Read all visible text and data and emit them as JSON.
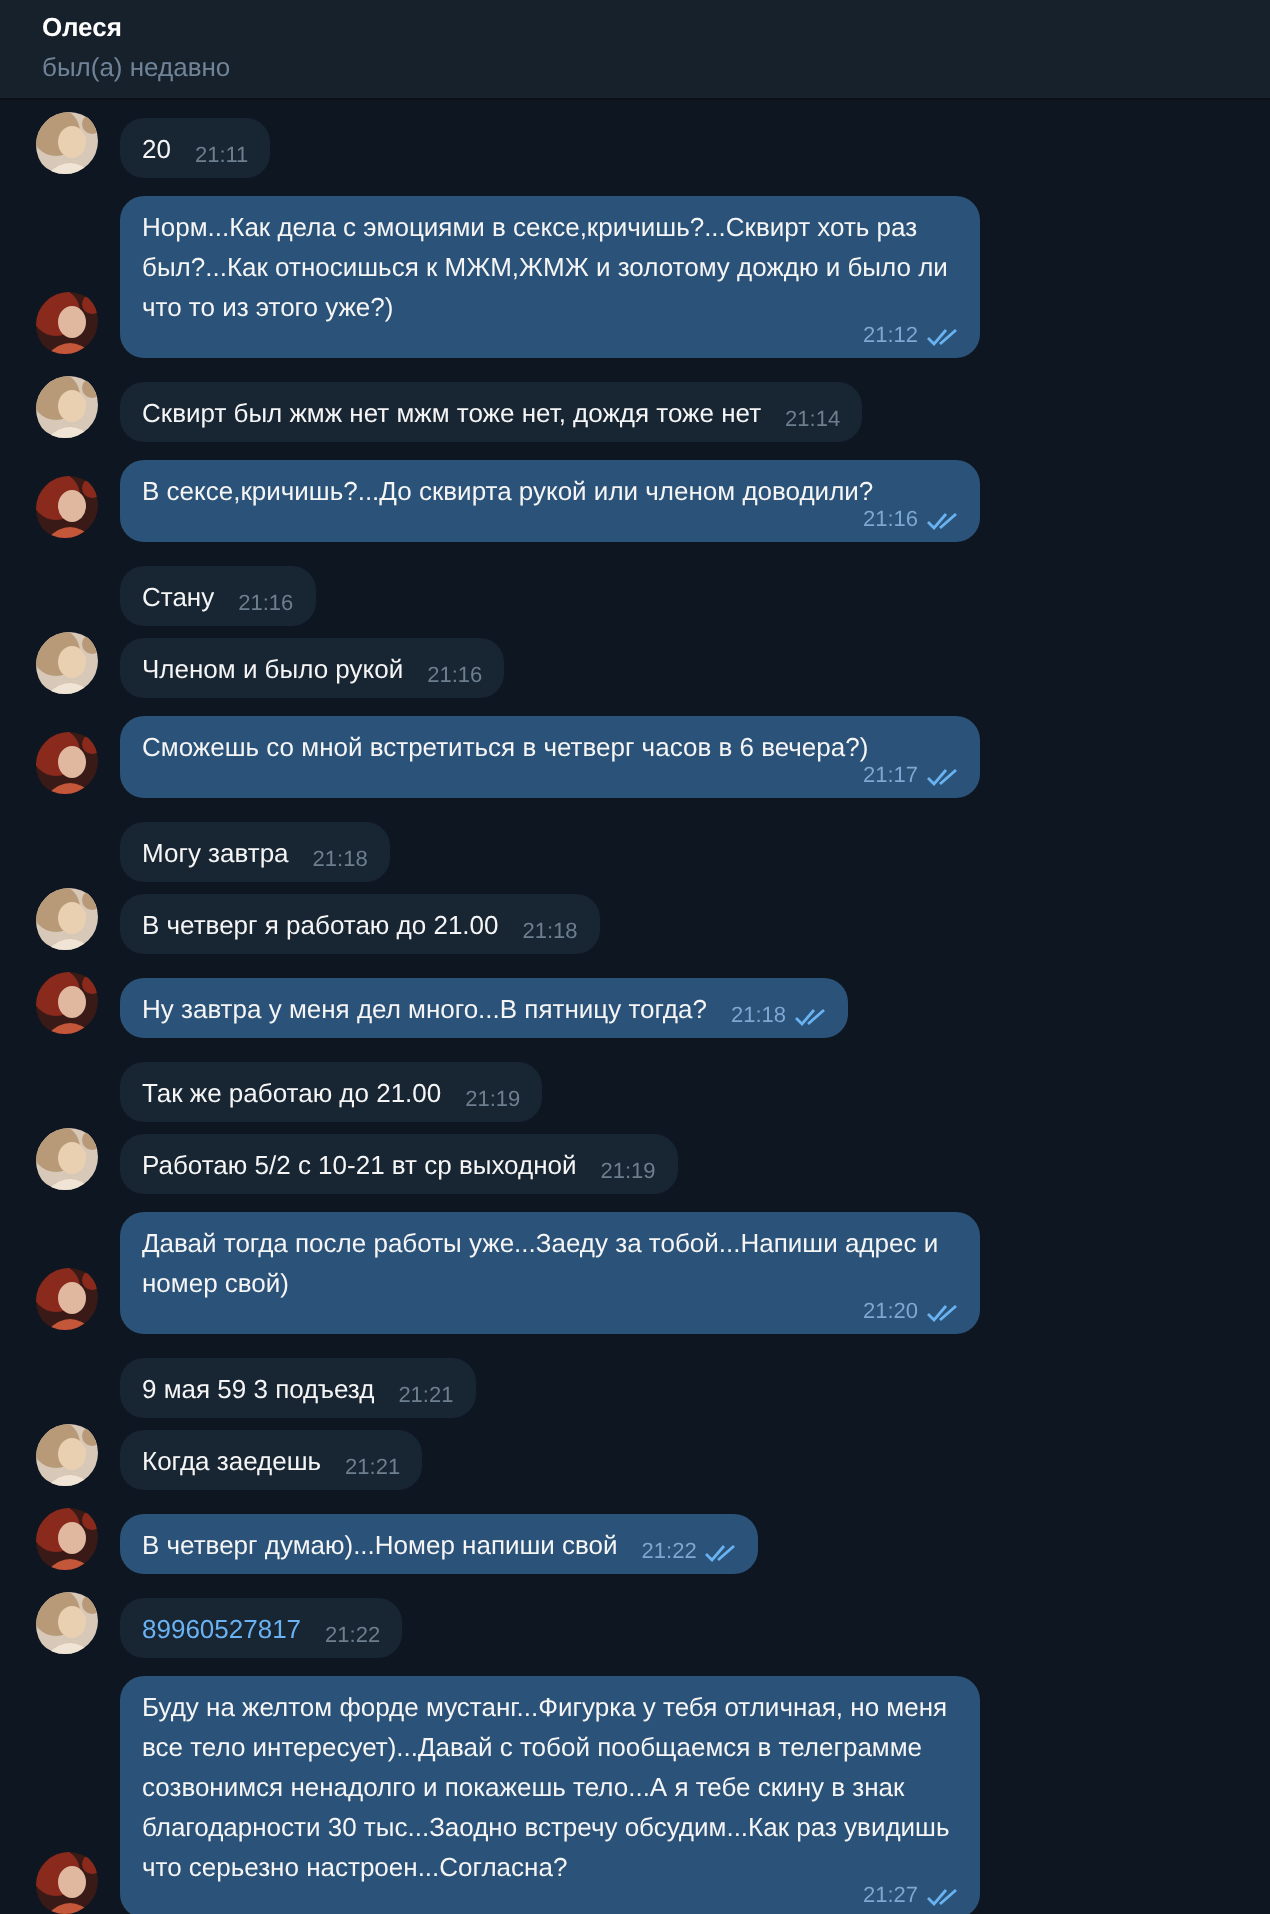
{
  "header": {
    "title": "Олеся",
    "status": "был(а) недавно"
  },
  "messages": [
    {
      "kind": "incoming",
      "text": "20",
      "time": "21:11"
    },
    {
      "kind": "outgoing",
      "text": "Норм...Как дела с эмоциями в сексе,кричишь?...Сквирт хоть раз был?...Как относишься к МЖМ,ЖМЖ и золотому дождю и было ли что то из этого уже?)",
      "time": "21:12",
      "read": true
    },
    {
      "kind": "incoming",
      "text": "Сквирт был жмж нет мжм тоже нет, дождя тоже нет",
      "time": "21:14"
    },
    {
      "kind": "outgoing",
      "text": "В сексе,кричишь?...До сквирта рукой или членом доводили?",
      "time": "21:16",
      "read": true
    },
    {
      "kind": "incoming",
      "text": "Стану",
      "time": "21:16"
    },
    {
      "kind": "incoming",
      "text": "Членом и было рукой",
      "time": "21:16"
    },
    {
      "kind": "outgoing",
      "text": "Сможешь со мной встретиться в четверг часов в 6 вечера?)",
      "time": "21:17",
      "read": true
    },
    {
      "kind": "incoming",
      "text": "Могу завтра",
      "time": "21:18"
    },
    {
      "kind": "incoming",
      "text": "В четверг я работаю до 21.00",
      "time": "21:18"
    },
    {
      "kind": "outgoing",
      "text": "Ну завтра у меня дел много...В пятницу тогда?",
      "time": "21:18",
      "read": true
    },
    {
      "kind": "incoming",
      "text": "Так же работаю до 21.00",
      "time": "21:19"
    },
    {
      "kind": "incoming",
      "text": "Работаю 5/2 с 10-21 вт ср выходной",
      "time": "21:19"
    },
    {
      "kind": "outgoing",
      "text": "Давай тогда после работы уже...Заеду за тобой...Напиши адрес и номер свой)",
      "time": "21:20",
      "read": true
    },
    {
      "kind": "incoming",
      "text": "9 мая 59 3 подъезд",
      "time": "21:21"
    },
    {
      "kind": "incoming",
      "text": "Когда заедешь",
      "time": "21:21"
    },
    {
      "kind": "outgoing",
      "text": "В четверг думаю)...Номер напиши свой",
      "time": "21:22",
      "read": true
    },
    {
      "kind": "incoming",
      "text": "89960527817",
      "time": "21:22",
      "link": true
    },
    {
      "kind": "outgoing",
      "text": "Буду на желтом форде мустанг...Фигурка у тебя отличная, но меня все тело интересует)...Давай с тобой пообщаемся в телеграмме созвонимся ненадолго и покажешь тело...А я тебе скину в знак благодарности 30 тыс...Заодно встречу обсудим...Как раз увидишь что серьезно настроен...Согласна?",
      "time": "21:27",
      "read": true
    }
  ]
}
